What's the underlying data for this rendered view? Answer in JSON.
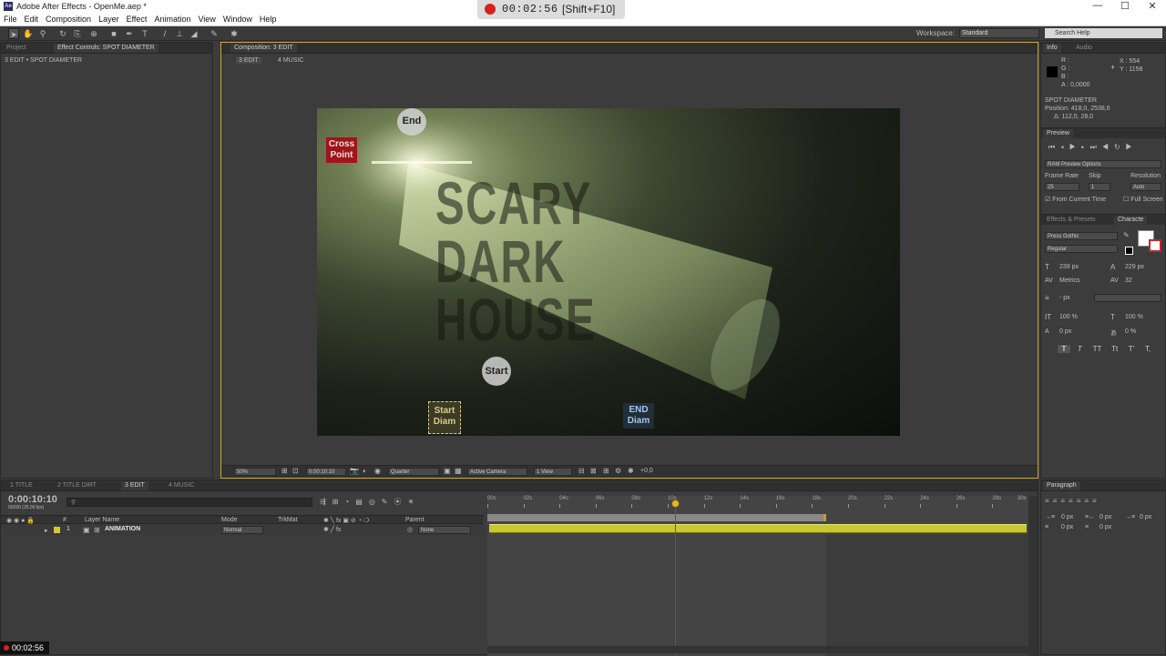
{
  "window": {
    "title": "Adobe After Effects - OpenMe.aep *",
    "app_icon": "Ae",
    "minimize": "—",
    "maximize": "☐",
    "close": "✕"
  },
  "menu": [
    "File",
    "Edit",
    "Composition",
    "Layer",
    "Effect",
    "Animation",
    "View",
    "Window",
    "Help"
  ],
  "recorder": {
    "time": "00:02:56",
    "shortcut": "[Shift+F10]"
  },
  "toolbar": {
    "workspace_label": "Workspace:",
    "workspace_value": "Standard",
    "search_help": "Search Help"
  },
  "left_panel": {
    "tabs": [
      "Project",
      "Effect Controls: SPOT DIAMETER"
    ],
    "breadcrumb": "3 EDIT • SPOT DIAMETER"
  },
  "comp_panel": {
    "tab": "Composition: 3 EDIT",
    "sub_tabs": [
      "3 EDIT",
      "4 MUSIC"
    ],
    "title_text": [
      "SCARY",
      "DARK",
      "HOUSE"
    ],
    "markers": {
      "end": "End",
      "start": "Start",
      "cross_point": [
        "Cross",
        "Point"
      ],
      "start_diam": [
        "Start",
        "Diam"
      ],
      "end_diam": [
        "END",
        "Diam"
      ]
    },
    "bottom": {
      "zoom": "50%",
      "timecode": "0:00:10:10",
      "resolution": "Quarter",
      "camera": "Active Camera",
      "view": "1 View",
      "exposure": "+0,0"
    }
  },
  "info_panel": {
    "tabs": [
      "Info",
      "Audio"
    ],
    "r": "R :",
    "g": "G :",
    "b": "B :",
    "a": "A : 0,0000",
    "x": "X : 554",
    "y": "Y : 1158",
    "layer": "SPOT DIAMETER",
    "position": "Position: 418,0, 2538,6",
    "delta": "Δ: 112,0, 28,0"
  },
  "preview_panel": {
    "tab": "Preview",
    "ram_options": "RAM Preview Options",
    "frame_rate_label": "Frame Rate",
    "skip_label": "Skip",
    "resolution_label": "Resolution",
    "frame_rate": "25",
    "skip": "1",
    "resolution": "Auto",
    "from_current": "From Current Time",
    "full_screen": "Full Screen"
  },
  "character_panel": {
    "tabs": [
      "Effects & Presets",
      "Characte"
    ],
    "font": "Press Gothic",
    "style": "Regular",
    "size": "239 px",
    "leading": "229 px",
    "kerning": "Metrics",
    "tracking": "32",
    "stroke": "- px",
    "vscale": "100 %",
    "hscale": "100 %",
    "baseline": "0 px",
    "tsume": "0 %",
    "styles": [
      "T",
      "T",
      "TT",
      "Tt",
      "T'",
      "T,"
    ]
  },
  "timeline": {
    "tabs": [
      "1 TITLE",
      "2 TITLE DIRT",
      "3 EDIT",
      "4 MUSIC"
    ],
    "timecode": "0:00:10:10",
    "fps_note": "00260 (25.00 fps)",
    "columns": {
      "num": "#",
      "layer_name": "Layer Name",
      "mode": "Mode",
      "trkmat": "TrkMat",
      "parent": "Parent"
    },
    "layers": [
      {
        "num": "1",
        "name": "ANIMATION",
        "mode": "Normal",
        "parent": "None"
      }
    ],
    "ruler": [
      "00s",
      "02s",
      "04s",
      "06s",
      "08s",
      "10s",
      "12s",
      "14s",
      "16s",
      "18s",
      "20s",
      "22s",
      "24s",
      "26s",
      "28s",
      "30s"
    ],
    "playhead_seconds": 10.4,
    "work_area_end_seconds": 18.8,
    "duration_seconds": 30
  },
  "paragraph_panel": {
    "tab": "Paragraph",
    "indent_left": "0 px",
    "indent_right": "0 px",
    "indent_first": "0 px",
    "space_before": "0 px",
    "space_after": "0 px"
  },
  "status": {
    "elapsed": "00:02:56"
  }
}
